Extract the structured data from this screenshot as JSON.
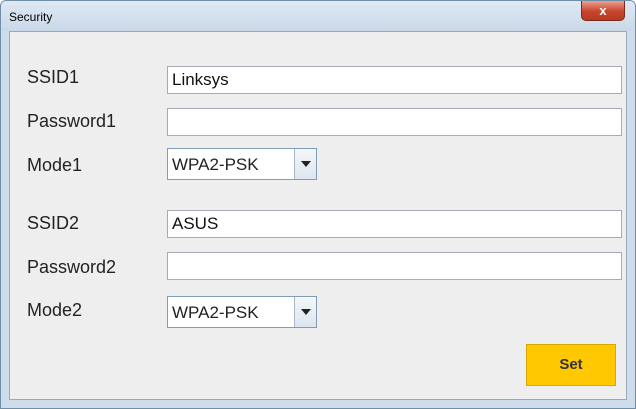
{
  "window": {
    "title": "Security",
    "close_label": "x"
  },
  "form": {
    "network1": {
      "ssid_label": "SSID1",
      "ssid_value": "Linksys",
      "password_label": "Password1",
      "password_value": "",
      "mode_label": "Mode1",
      "mode_value": "WPA2-PSK"
    },
    "network2": {
      "ssid_label": "SSID2",
      "ssid_value": "ASUS",
      "password_label": "Password2",
      "password_value": "",
      "mode_label": "Mode2",
      "mode_value": "WPA2-PSK"
    },
    "set_label": "Set"
  },
  "colors": {
    "set_button": "#ffc800",
    "close_button": "#c8452b"
  },
  "icons": {
    "close": "close-icon",
    "dropdown": "chevron-down-icon"
  }
}
